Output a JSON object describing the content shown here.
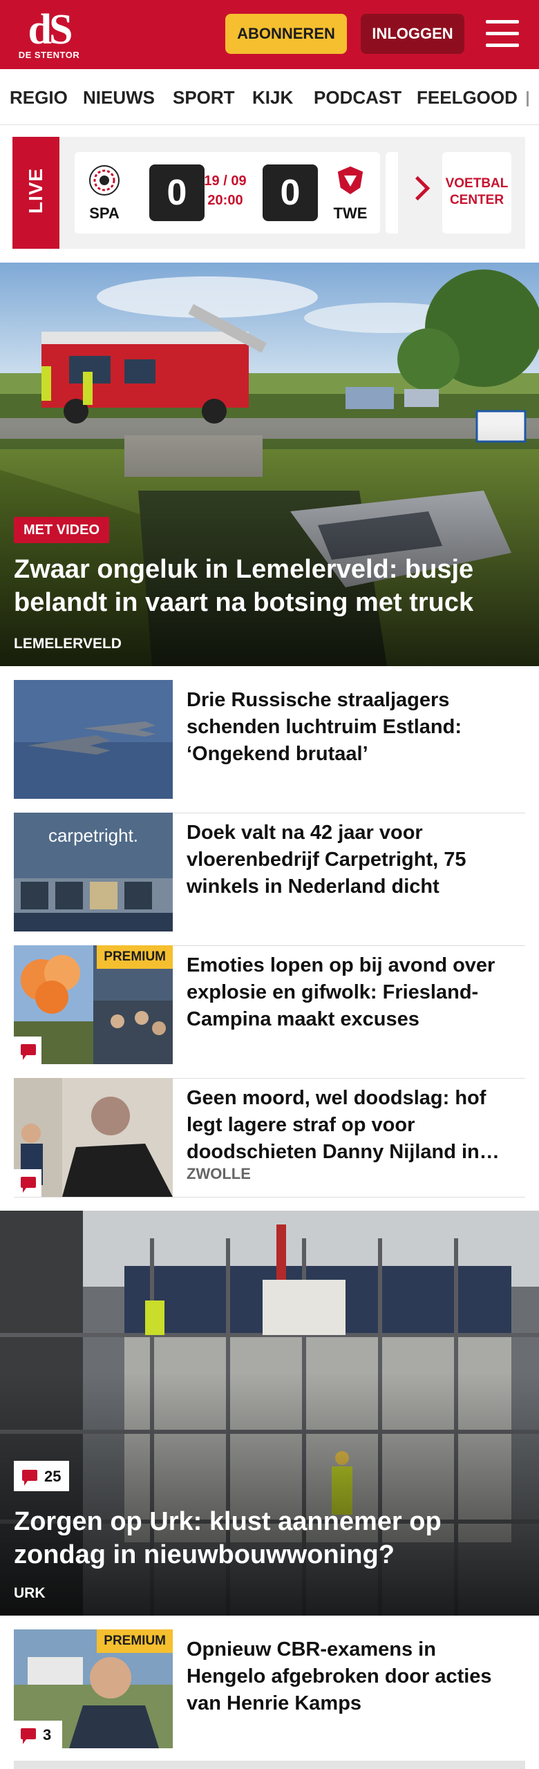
{
  "header": {
    "logo_mark": "dS",
    "logo_name": "DE STENTOR",
    "subscribe_label": "ABONNEREN",
    "login_label": "INLOGGEN"
  },
  "nav": {
    "items": [
      "REGIO",
      "NIEUWS",
      "SPORT",
      "KIJK",
      "PODCAST",
      "FEELGOOD"
    ]
  },
  "live": {
    "label": "LIVE",
    "match": {
      "home": "SPA",
      "away": "TWE",
      "home_score": "0",
      "away_score": "0",
      "date": "19 / 09",
      "time": "20:00"
    },
    "voetbal_center": "VOETBAL CENTER"
  },
  "hero1": {
    "tag": "MET VIDEO",
    "title": "Zwaar ongeluk in Lemelerveld: busje belandt in vaart na botsing met truck",
    "location": "LEMELERVELD"
  },
  "articles": [
    {
      "title": "Drie Russische straaljagers schenden luchtruim Estland: ‘Ongekend brutaal’"
    },
    {
      "title": "Doek valt na 42 jaar voor vloerenbedrijf Carpetright, 75 winkels in Nederland dicht",
      "thumb_text": "carpetright."
    },
    {
      "title": "Emoties lopen op bij avond over explosie en gifwolk: Friesland-Campina maakt excuses",
      "premium": "PREMIUM"
    },
    {
      "title": "Geen moord, wel doodslag: hof legt lagere straf op voor doodschieten Danny Nijland in…",
      "location": "ZWOLLE"
    }
  ],
  "hero2": {
    "comments": "25",
    "title": "Zorgen op Urk: klust aannemer op zondag in nieuwbouwwoning?",
    "location": "URK"
  },
  "article5": {
    "title": "Opnieuw CBR-examens in Hengelo afgebroken door acties van Henrie Kamps",
    "premium": "PREMIUM",
    "comments": "3"
  },
  "colors": {
    "brand_red": "#c8102e",
    "premium_yellow": "#f5bf2f",
    "login_dark_red": "#8e0e1f"
  }
}
